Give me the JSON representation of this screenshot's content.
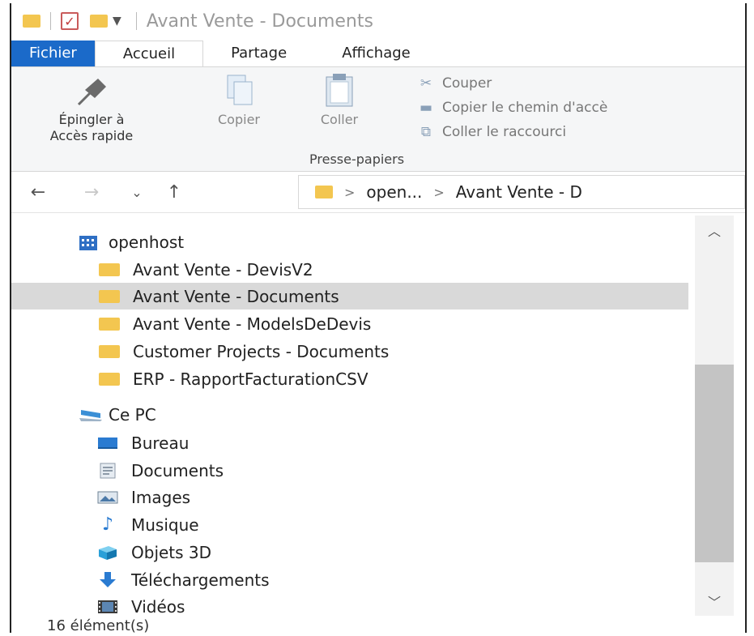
{
  "window": {
    "title": "Avant Vente - Documents"
  },
  "tabs": [
    {
      "label": "Fichier"
    },
    {
      "label": "Accueil"
    },
    {
      "label": "Partage"
    },
    {
      "label": "Affichage"
    }
  ],
  "ribbon": {
    "pin_line1": "Épingler à",
    "pin_line2": "Accès rapide",
    "copy": "Copier",
    "paste": "Coller",
    "cut": "Couper",
    "copy_path": "Copier le chemin d'accè",
    "paste_shortcut": "Coller le raccourci",
    "group": "Presse-papiers"
  },
  "address": {
    "segments": [
      "open...",
      "Avant Vente - D"
    ]
  },
  "tree": {
    "root": "openhost",
    "libraries": [
      {
        "label": "Avant Vente - DevisV2",
        "selected": false
      },
      {
        "label": "Avant Vente - Documents",
        "selected": true
      },
      {
        "label": "Avant Vente - ModelsDeDevis",
        "selected": false
      },
      {
        "label": "Customer Projects - Documents",
        "selected": false
      },
      {
        "label": "ERP - RapportFacturationCSV",
        "selected": false
      }
    ],
    "pc": "Ce PC",
    "pc_items": [
      {
        "label": "Bureau",
        "icon": "desktop-icon"
      },
      {
        "label": "Documents",
        "icon": "documents-icon"
      },
      {
        "label": "Images",
        "icon": "images-icon"
      },
      {
        "label": "Musique",
        "icon": "music-icon"
      },
      {
        "label": "Objets 3D",
        "icon": "objects-3d-icon"
      },
      {
        "label": "Téléchargements",
        "icon": "download-icon"
      },
      {
        "label": "Vidéos",
        "icon": "videos-icon"
      }
    ]
  },
  "status": {
    "count": "16 élément(s)"
  },
  "colors": {
    "accent": "#1b6ac9",
    "folder": "#f3c650",
    "selection": "#d9d9d9"
  }
}
